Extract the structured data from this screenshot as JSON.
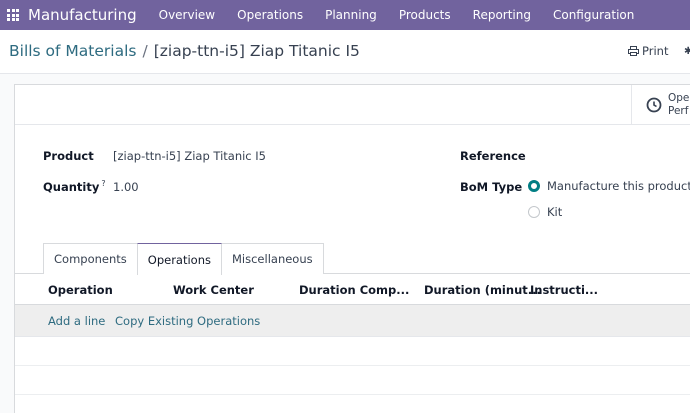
{
  "navbar": {
    "app_name": "Manufacturing",
    "menu": [
      "Overview",
      "Operations",
      "Planning",
      "Products",
      "Reporting",
      "Configuration"
    ]
  },
  "breadcrumb": {
    "parent": "Bills of Materials",
    "separator": "/",
    "current": "[ziap-ttn-i5] Ziap Titanic I5"
  },
  "actions": {
    "print_label": "Print"
  },
  "smart_button": {
    "line1": "Ope",
    "line2": "Perf"
  },
  "form": {
    "product_label": "Product",
    "product_value": "[ziap-ttn-i5] Ziap Titanic I5",
    "quantity_label": "Quantity",
    "quantity_tooltip": "?",
    "quantity_value": "1.00",
    "reference_label": "Reference",
    "bom_type_label": "BoM Type",
    "bom_type_options": [
      {
        "label": "Manufacture this product",
        "checked": true
      },
      {
        "label": "Kit",
        "checked": false
      }
    ]
  },
  "tabs": [
    {
      "label": "Components",
      "active": false
    },
    {
      "label": "Operations",
      "active": true
    },
    {
      "label": "Miscellaneous",
      "active": false
    }
  ],
  "table": {
    "columns": [
      "Operation",
      "Work Center",
      "Duration Comp...",
      "Duration (minut...",
      "Instructi..."
    ],
    "add_line_label": "Add a line",
    "copy_label": "Copy Existing Operations"
  },
  "colors": {
    "navbar": "#71639e",
    "link": "#2e6b80",
    "radio_checked": "#017e84"
  }
}
